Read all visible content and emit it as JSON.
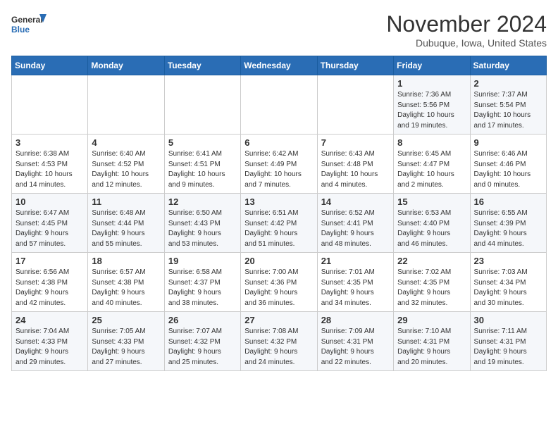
{
  "header": {
    "logo_general": "General",
    "logo_blue": "Blue",
    "month_title": "November 2024",
    "location": "Dubuque, Iowa, United States"
  },
  "weekdays": [
    "Sunday",
    "Monday",
    "Tuesday",
    "Wednesday",
    "Thursday",
    "Friday",
    "Saturday"
  ],
  "weeks": [
    [
      {
        "day": "",
        "info": ""
      },
      {
        "day": "",
        "info": ""
      },
      {
        "day": "",
        "info": ""
      },
      {
        "day": "",
        "info": ""
      },
      {
        "day": "",
        "info": ""
      },
      {
        "day": "1",
        "info": "Sunrise: 7:36 AM\nSunset: 5:56 PM\nDaylight: 10 hours\nand 19 minutes."
      },
      {
        "day": "2",
        "info": "Sunrise: 7:37 AM\nSunset: 5:54 PM\nDaylight: 10 hours\nand 17 minutes."
      }
    ],
    [
      {
        "day": "3",
        "info": "Sunrise: 6:38 AM\nSunset: 4:53 PM\nDaylight: 10 hours\nand 14 minutes."
      },
      {
        "day": "4",
        "info": "Sunrise: 6:40 AM\nSunset: 4:52 PM\nDaylight: 10 hours\nand 12 minutes."
      },
      {
        "day": "5",
        "info": "Sunrise: 6:41 AM\nSunset: 4:51 PM\nDaylight: 10 hours\nand 9 minutes."
      },
      {
        "day": "6",
        "info": "Sunrise: 6:42 AM\nSunset: 4:49 PM\nDaylight: 10 hours\nand 7 minutes."
      },
      {
        "day": "7",
        "info": "Sunrise: 6:43 AM\nSunset: 4:48 PM\nDaylight: 10 hours\nand 4 minutes."
      },
      {
        "day": "8",
        "info": "Sunrise: 6:45 AM\nSunset: 4:47 PM\nDaylight: 10 hours\nand 2 minutes."
      },
      {
        "day": "9",
        "info": "Sunrise: 6:46 AM\nSunset: 4:46 PM\nDaylight: 10 hours\nand 0 minutes."
      }
    ],
    [
      {
        "day": "10",
        "info": "Sunrise: 6:47 AM\nSunset: 4:45 PM\nDaylight: 9 hours\nand 57 minutes."
      },
      {
        "day": "11",
        "info": "Sunrise: 6:48 AM\nSunset: 4:44 PM\nDaylight: 9 hours\nand 55 minutes."
      },
      {
        "day": "12",
        "info": "Sunrise: 6:50 AM\nSunset: 4:43 PM\nDaylight: 9 hours\nand 53 minutes."
      },
      {
        "day": "13",
        "info": "Sunrise: 6:51 AM\nSunset: 4:42 PM\nDaylight: 9 hours\nand 51 minutes."
      },
      {
        "day": "14",
        "info": "Sunrise: 6:52 AM\nSunset: 4:41 PM\nDaylight: 9 hours\nand 48 minutes."
      },
      {
        "day": "15",
        "info": "Sunrise: 6:53 AM\nSunset: 4:40 PM\nDaylight: 9 hours\nand 46 minutes."
      },
      {
        "day": "16",
        "info": "Sunrise: 6:55 AM\nSunset: 4:39 PM\nDaylight: 9 hours\nand 44 minutes."
      }
    ],
    [
      {
        "day": "17",
        "info": "Sunrise: 6:56 AM\nSunset: 4:38 PM\nDaylight: 9 hours\nand 42 minutes."
      },
      {
        "day": "18",
        "info": "Sunrise: 6:57 AM\nSunset: 4:38 PM\nDaylight: 9 hours\nand 40 minutes."
      },
      {
        "day": "19",
        "info": "Sunrise: 6:58 AM\nSunset: 4:37 PM\nDaylight: 9 hours\nand 38 minutes."
      },
      {
        "day": "20",
        "info": "Sunrise: 7:00 AM\nSunset: 4:36 PM\nDaylight: 9 hours\nand 36 minutes."
      },
      {
        "day": "21",
        "info": "Sunrise: 7:01 AM\nSunset: 4:35 PM\nDaylight: 9 hours\nand 34 minutes."
      },
      {
        "day": "22",
        "info": "Sunrise: 7:02 AM\nSunset: 4:35 PM\nDaylight: 9 hours\nand 32 minutes."
      },
      {
        "day": "23",
        "info": "Sunrise: 7:03 AM\nSunset: 4:34 PM\nDaylight: 9 hours\nand 30 minutes."
      }
    ],
    [
      {
        "day": "24",
        "info": "Sunrise: 7:04 AM\nSunset: 4:33 PM\nDaylight: 9 hours\nand 29 minutes."
      },
      {
        "day": "25",
        "info": "Sunrise: 7:05 AM\nSunset: 4:33 PM\nDaylight: 9 hours\nand 27 minutes."
      },
      {
        "day": "26",
        "info": "Sunrise: 7:07 AM\nSunset: 4:32 PM\nDaylight: 9 hours\nand 25 minutes."
      },
      {
        "day": "27",
        "info": "Sunrise: 7:08 AM\nSunset: 4:32 PM\nDaylight: 9 hours\nand 24 minutes."
      },
      {
        "day": "28",
        "info": "Sunrise: 7:09 AM\nSunset: 4:31 PM\nDaylight: 9 hours\nand 22 minutes."
      },
      {
        "day": "29",
        "info": "Sunrise: 7:10 AM\nSunset: 4:31 PM\nDaylight: 9 hours\nand 20 minutes."
      },
      {
        "day": "30",
        "info": "Sunrise: 7:11 AM\nSunset: 4:31 PM\nDaylight: 9 hours\nand 19 minutes."
      }
    ]
  ]
}
